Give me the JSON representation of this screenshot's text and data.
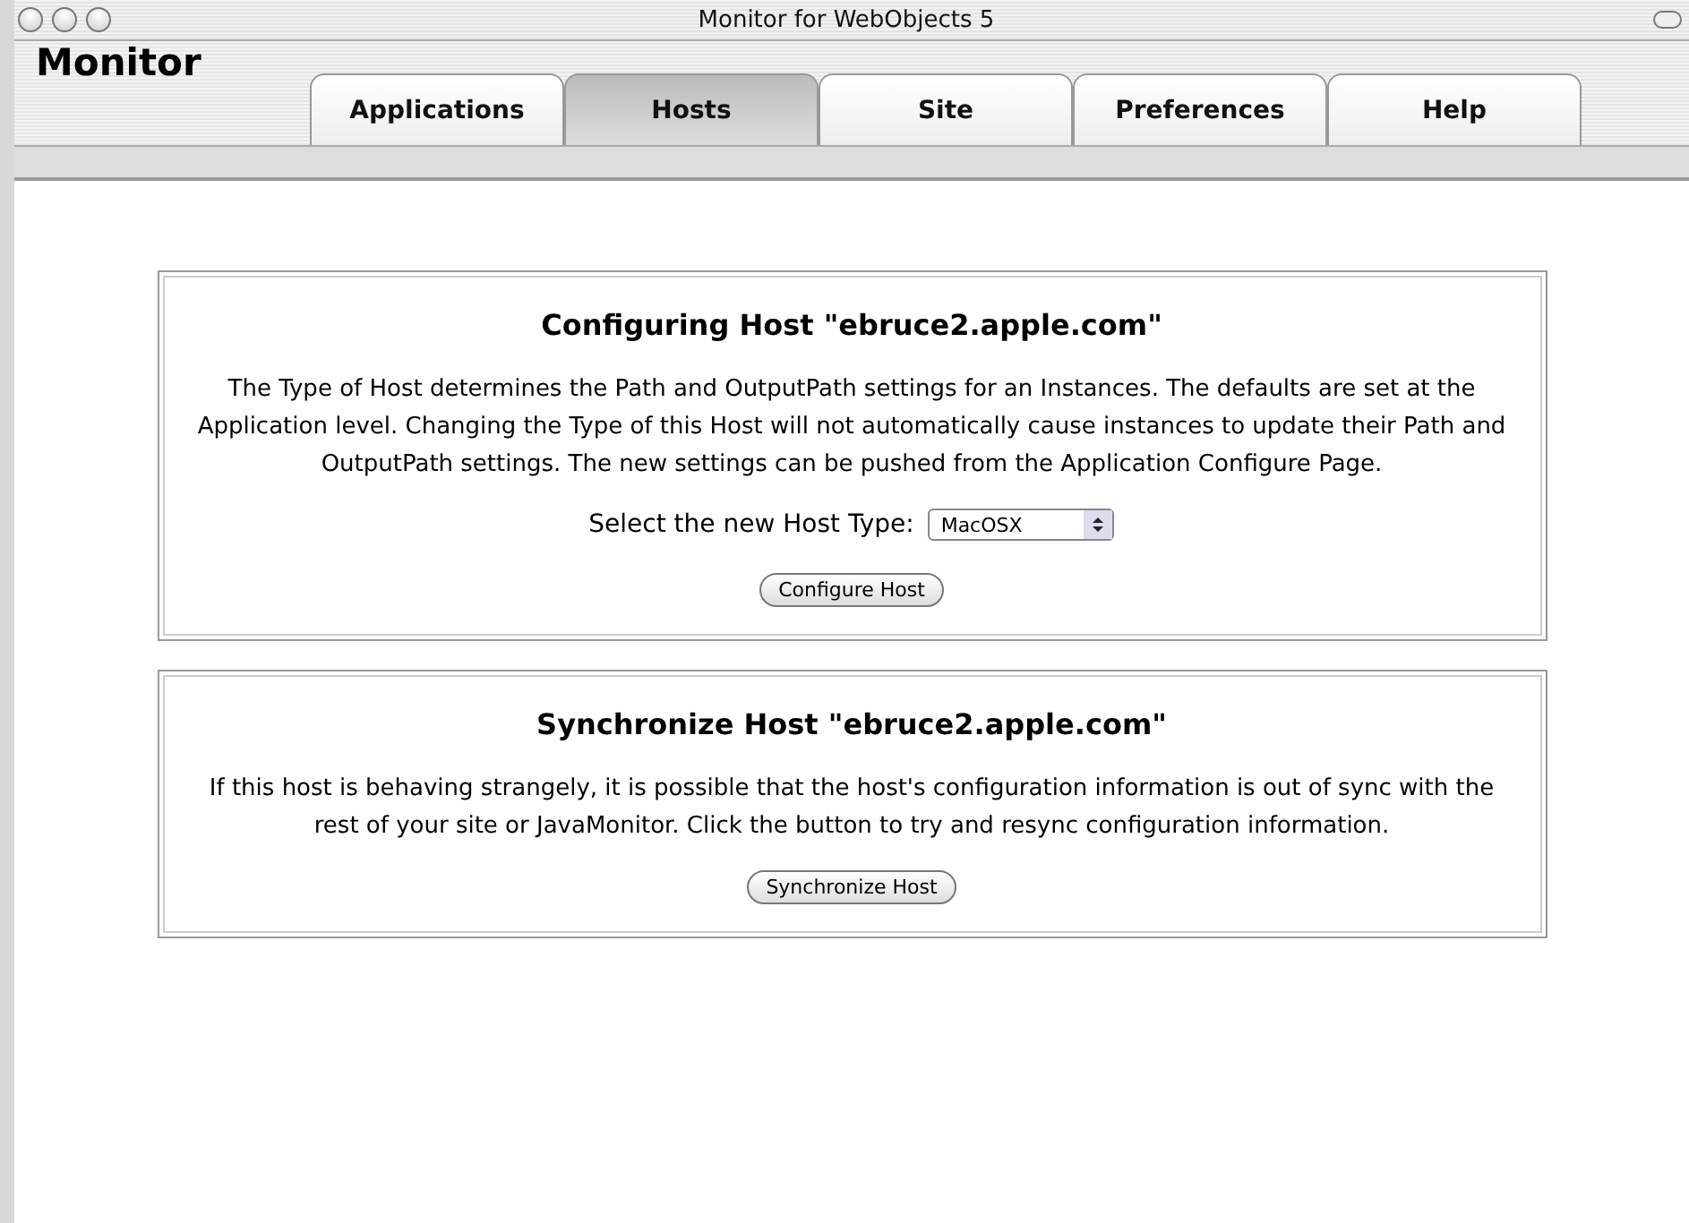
{
  "window": {
    "title": "Monitor for WebObjects 5"
  },
  "app_title": "Monitor",
  "tabs": [
    {
      "label": "Applications",
      "selected": false
    },
    {
      "label": "Hosts",
      "selected": true
    },
    {
      "label": "Site",
      "selected": false
    },
    {
      "label": "Preferences",
      "selected": false
    },
    {
      "label": "Help",
      "selected": false
    }
  ],
  "panels": [
    {
      "kind": "configure",
      "heading": "Configuring Host \"ebruce2.apple.com\"",
      "text": "The Type of Host determines the Path and OutputPath settings for an Instances. The defaults are set at the Application level. Changing the Type of this Host will not automatically cause instances to update their Path and OutputPath settings. The new settings can be pushed from the Application Configure Page.",
      "select_label": "Select the new Host Type:",
      "select_value": "MacOSX",
      "button": "Configure Host"
    },
    {
      "kind": "sync",
      "heading": "Synchronize Host \"ebruce2.apple.com\"",
      "text": "If this host is behaving strangely, it is possible that the host's configuration information is out of sync with the rest of your site or JavaMonitor. Click the button to try and resync configuration information.",
      "button": "Synchronize Host"
    }
  ]
}
